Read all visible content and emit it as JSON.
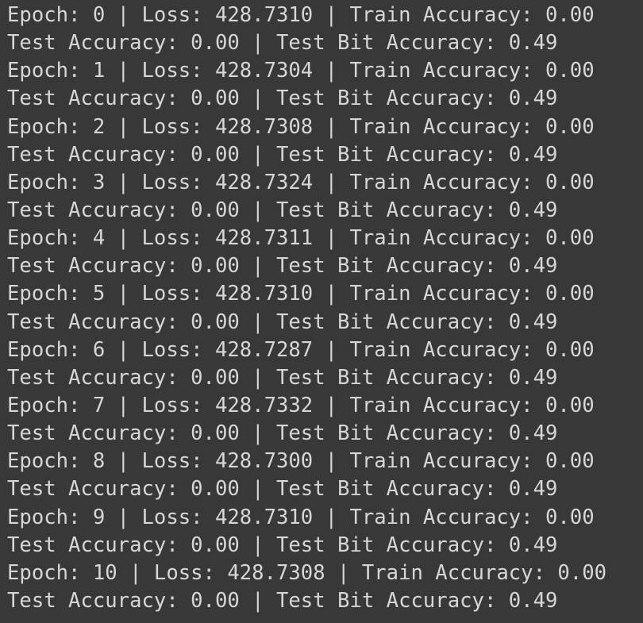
{
  "output": {
    "lines": [
      "Epoch: 0 | Loss: 428.7310 | Train Accuracy: 0.00",
      "Test Accuracy: 0.00 | Test Bit Accuracy: 0.49",
      "Epoch: 1 | Loss: 428.7304 | Train Accuracy: 0.00",
      "Test Accuracy: 0.00 | Test Bit Accuracy: 0.49",
      "Epoch: 2 | Loss: 428.7308 | Train Accuracy: 0.00",
      "Test Accuracy: 0.00 | Test Bit Accuracy: 0.49",
      "Epoch: 3 | Loss: 428.7324 | Train Accuracy: 0.00",
      "Test Accuracy: 0.00 | Test Bit Accuracy: 0.49",
      "Epoch: 4 | Loss: 428.7311 | Train Accuracy: 0.00",
      "Test Accuracy: 0.00 | Test Bit Accuracy: 0.49",
      "Epoch: 5 | Loss: 428.7310 | Train Accuracy: 0.00",
      "Test Accuracy: 0.00 | Test Bit Accuracy: 0.49",
      "Epoch: 6 | Loss: 428.7287 | Train Accuracy: 0.00",
      "Test Accuracy: 0.00 | Test Bit Accuracy: 0.49",
      "Epoch: 7 | Loss: 428.7332 | Train Accuracy: 0.00",
      "Test Accuracy: 0.00 | Test Bit Accuracy: 0.49",
      "Epoch: 8 | Loss: 428.7300 | Train Accuracy: 0.00",
      "Test Accuracy: 0.00 | Test Bit Accuracy: 0.49",
      "Epoch: 9 | Loss: 428.7310 | Train Accuracy: 0.00",
      "Test Accuracy: 0.00 | Test Bit Accuracy: 0.49",
      "Epoch: 10 | Loss: 428.7308 | Train Accuracy: 0.00",
      "Test Accuracy: 0.00 | Test Bit Accuracy: 0.49"
    ]
  },
  "colors": {
    "background": "#383838",
    "text": "#d6d6d6"
  }
}
